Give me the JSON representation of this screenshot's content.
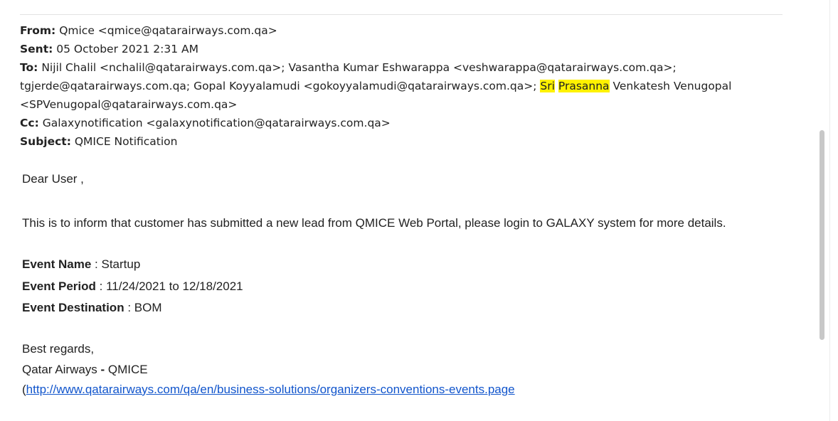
{
  "header": {
    "from_label": "From:",
    "from_value": "Qmice <qmice@qatarairways.com.qa>",
    "sent_label": "Sent:",
    "sent_value": "05 October 2021 2:31 AM",
    "to_label": "To:",
    "to_part1": "Nijil Chalil <nchalil@qatarairways.com.qa>; Vasantha Kumar Eshwarappa <veshwarappa@qatarairways.com.qa>; tgjerde@qatarairways.com.qa; Gopal Koyyalamudi <gokoyyalamudi@qatarairways.com.qa>;",
    "to_hl1": "Sri",
    "to_hl2": "Prasanna",
    "to_part2": "Venkatesh Venugopal <SPVenugopal@qatarairways.com.qa>",
    "cc_label": "Cc:",
    "cc_value": "Galaxynotification <galaxynotification@qatarairways.com.qa>",
    "subject_label": "Subject:",
    "subject_value": "QMICE Notification"
  },
  "body": {
    "greeting": "Dear User ,",
    "intro": "This is to inform that customer has submitted a new lead from QMICE Web Portal, please login to GALAXY system for more details.",
    "events": [
      {
        "key": "Event Name",
        "value": " : Startup"
      },
      {
        "key": "Event Period",
        "value": " : 11/24/2021 to 12/18/2021"
      },
      {
        "key": "Event Destination",
        "value": " : BOM"
      }
    ],
    "regards": "Best regards,",
    "sig_name": "Qatar Airways",
    "sig_dash": " - ",
    "sig_team": "QMICE",
    "link_open": "(",
    "link_url": "http://www.qatarairways.com/qa/en/business-solutions/organizers-conventions-events.page"
  },
  "colors": {
    "highlight": "#fff200",
    "link": "#1155cc",
    "text": "#222222"
  }
}
